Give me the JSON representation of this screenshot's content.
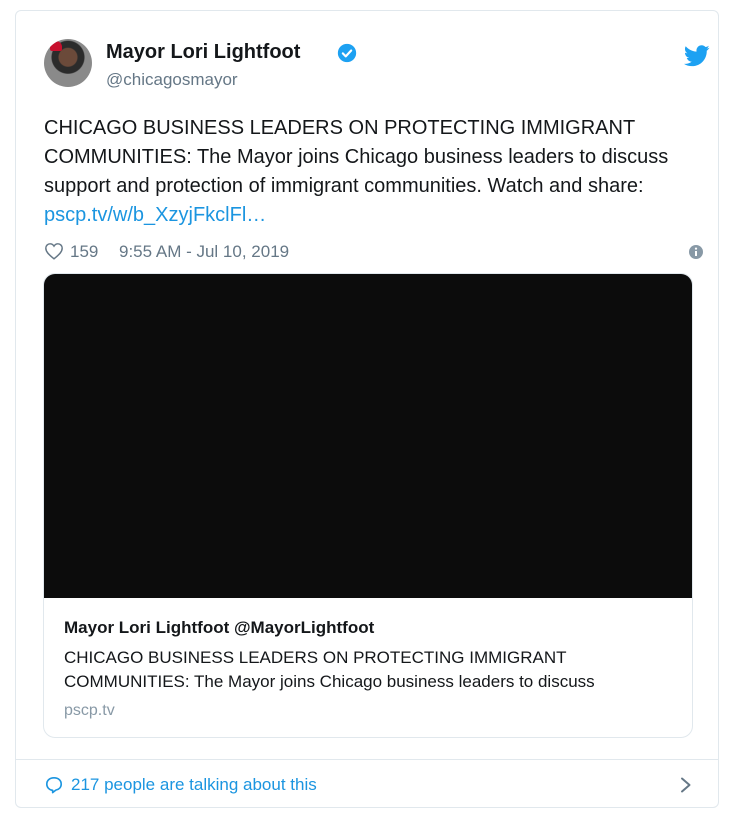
{
  "author": {
    "name": "Mayor Lori Lightfoot",
    "handle": "@chicagosmayor"
  },
  "tweet": {
    "text_main": "CHICAGO BUSINESS LEADERS ON PROTECTING IMMIGRANT COMMUNITIES: The Mayor joins Chicago business leaders to discuss support and protection of immigrant communities. Watch and share: ",
    "link_text": "pscp.tv/w/b_XzyjFkclFl…",
    "likes": "159",
    "timestamp": "9:55 AM - Jul 10, 2019"
  },
  "card": {
    "title": "Mayor Lori Lightfoot @MayorLightfoot",
    "description": "CHICAGO BUSINESS LEADERS ON PROTECTING IMMIGRANT COMMUNITIES: The Mayor joins Chicago business leaders to discuss",
    "domain": "pscp.tv"
  },
  "footer": {
    "talking_text": "217 people are talking about this"
  },
  "colors": {
    "link": "#1b95e0",
    "verified": "#1da1f2",
    "muted": "#657786",
    "border": "#e1e8ed"
  }
}
